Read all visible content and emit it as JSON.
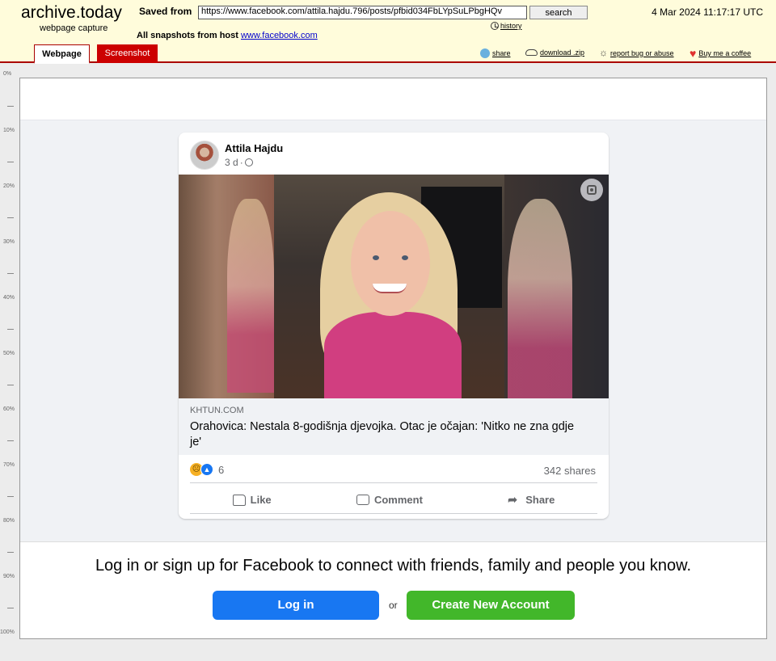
{
  "archive": {
    "logo": "archive.today",
    "logo_sub": "webpage capture",
    "saved_label": "Saved from",
    "url": "https://www.facebook.com/attila.hajdu.796/posts/pfbid034FbLYpSuLPbgHQv",
    "search_label": "search",
    "history_label": "history",
    "date": "4 Mar 2024 11:17:17 UTC",
    "all_snapshots_label": "All snapshots",
    "from_host_label": "from host",
    "host": "www.facebook.com",
    "tabs": [
      "Webpage",
      "Screenshot"
    ],
    "tools": {
      "share": "share",
      "download": "download .zip",
      "report": "report bug or abuse",
      "coffee": "Buy me a coffee"
    },
    "ruler": [
      "0%",
      "10%",
      "20%",
      "30%",
      "40%",
      "50%",
      "60%",
      "70%",
      "80%",
      "90%",
      "100%"
    ]
  },
  "post": {
    "author": "Attila Hajdu",
    "time": "3 d",
    "separator": "·",
    "link_domain": "KHTUN.COM",
    "link_title": "Orahovica: Nestala 8-godišnja djevojka. Otac je očajan: 'Nitko ne zna gdje je'",
    "reaction_count": "6",
    "shares": "342 shares",
    "actions": [
      "Like",
      "Comment",
      "Share"
    ]
  },
  "login": {
    "prompt": "Log in or sign up for Facebook to connect with friends, family and people you know.",
    "login_button": "Log in",
    "or": "or",
    "create_button": "Create New Account"
  },
  "colors": {
    "archive_header_bg": "#fffcdb",
    "archive_accent": "#cc0000",
    "fb_blue": "#1877f2",
    "fb_green": "#42b72a"
  }
}
